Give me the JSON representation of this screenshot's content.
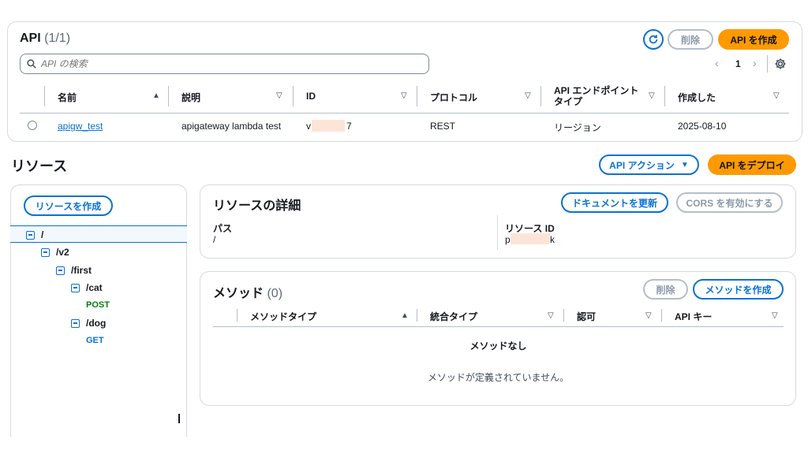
{
  "api_panel": {
    "title": "API",
    "count": "(1/1)",
    "refresh_icon": "refresh-icon",
    "delete_label": "削除",
    "create_label": "API を作成",
    "search_placeholder": "API の検索",
    "page_number": "1",
    "columns": [
      "名前",
      "説明",
      "ID",
      "プロトコル",
      "API エンドポイントタイプ",
      "作成した"
    ],
    "rows": [
      {
        "name": "apigw_test",
        "description": "apigateway lambda test",
        "id_prefix": "v",
        "id_suffix": "7",
        "protocol": "REST",
        "endpoint_type": "リージョン",
        "created": "2025-08-10"
      }
    ]
  },
  "resources": {
    "heading": "リソース",
    "api_actions_label": "API アクション",
    "deploy_label": "API をデプロイ",
    "create_resource_label": "リソースを作成",
    "tree": [
      {
        "label": "/"
      },
      {
        "label": "/v2"
      },
      {
        "label": "/first"
      },
      {
        "label": "/cat"
      },
      {
        "label": "POST"
      },
      {
        "label": "/dog"
      },
      {
        "label": "GET"
      }
    ]
  },
  "details": {
    "title": "リソースの詳細",
    "update_docs_label": "ドキュメントを更新",
    "cors_label": "CORS を有効にする",
    "path_label": "パス",
    "path_value": "/",
    "resource_id_label": "リソース ID",
    "resource_id_prefix": "p",
    "resource_id_suffix": "k"
  },
  "methods": {
    "title": "メソッド",
    "count": "(0)",
    "delete_label": "削除",
    "create_label": "メソッドを作成",
    "columns": [
      "メソッドタイプ",
      "統合タイプ",
      "認可",
      "API キー"
    ],
    "empty_title": "メソッドなし",
    "empty_message": "メソッドが定義されていません。"
  },
  "colors": {
    "primary": "#ff9900",
    "link": "#0972d3",
    "post": "#037f0c",
    "get": "#0972d3"
  }
}
